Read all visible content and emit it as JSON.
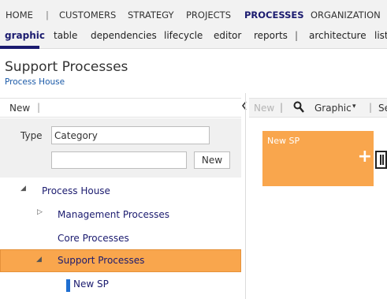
{
  "main_nav": {
    "items": [
      "HOME",
      "CUSTOMERS",
      "STRATEGY",
      "PROJECTS",
      "PROCESSES",
      "ORGANIZATION"
    ],
    "active": "PROCESSES",
    "separator": "|"
  },
  "sub_nav": {
    "items": [
      "graphic",
      "table",
      "dependencies",
      "lifecycle",
      "editor",
      "reports",
      "architecture",
      "list"
    ],
    "active": "graphic",
    "separator": "|"
  },
  "page": {
    "title": "Support Processes",
    "breadcrumb": "Process House"
  },
  "left_toolbar": {
    "new_label": "New",
    "separator": "|"
  },
  "collapse_icon": "chevron-left-icon",
  "filter": {
    "type_label": "Type",
    "type_value": "Category",
    "search_value": "",
    "new_button": "New"
  },
  "tree": {
    "items": [
      {
        "label": "Process House",
        "expanded": true,
        "toggle": "◢"
      },
      {
        "label": "Management Processes",
        "expanded": false,
        "toggle": "▷"
      },
      {
        "label": "Core Processes",
        "expanded": false,
        "toggle": ""
      },
      {
        "label": "Support Processes",
        "expanded": true,
        "toggle": "◢",
        "selected": true
      },
      {
        "label": "New SP",
        "expanded": false,
        "toggle": ""
      }
    ]
  },
  "right_toolbar": {
    "new_label": "New",
    "separator": "|",
    "zoom_icon": "zoom-icon",
    "view_label": "Graphic",
    "view_caret": "▾",
    "next_label": "Se"
  },
  "canvas": {
    "box_title": "New SP",
    "box_plus": "+",
    "box_color": "#f9a64d"
  },
  "colors": {
    "accent": "#1b1b6f",
    "selection": "#f9a64d",
    "link": "#1b5aa8",
    "marker": "#1f6fd1"
  }
}
